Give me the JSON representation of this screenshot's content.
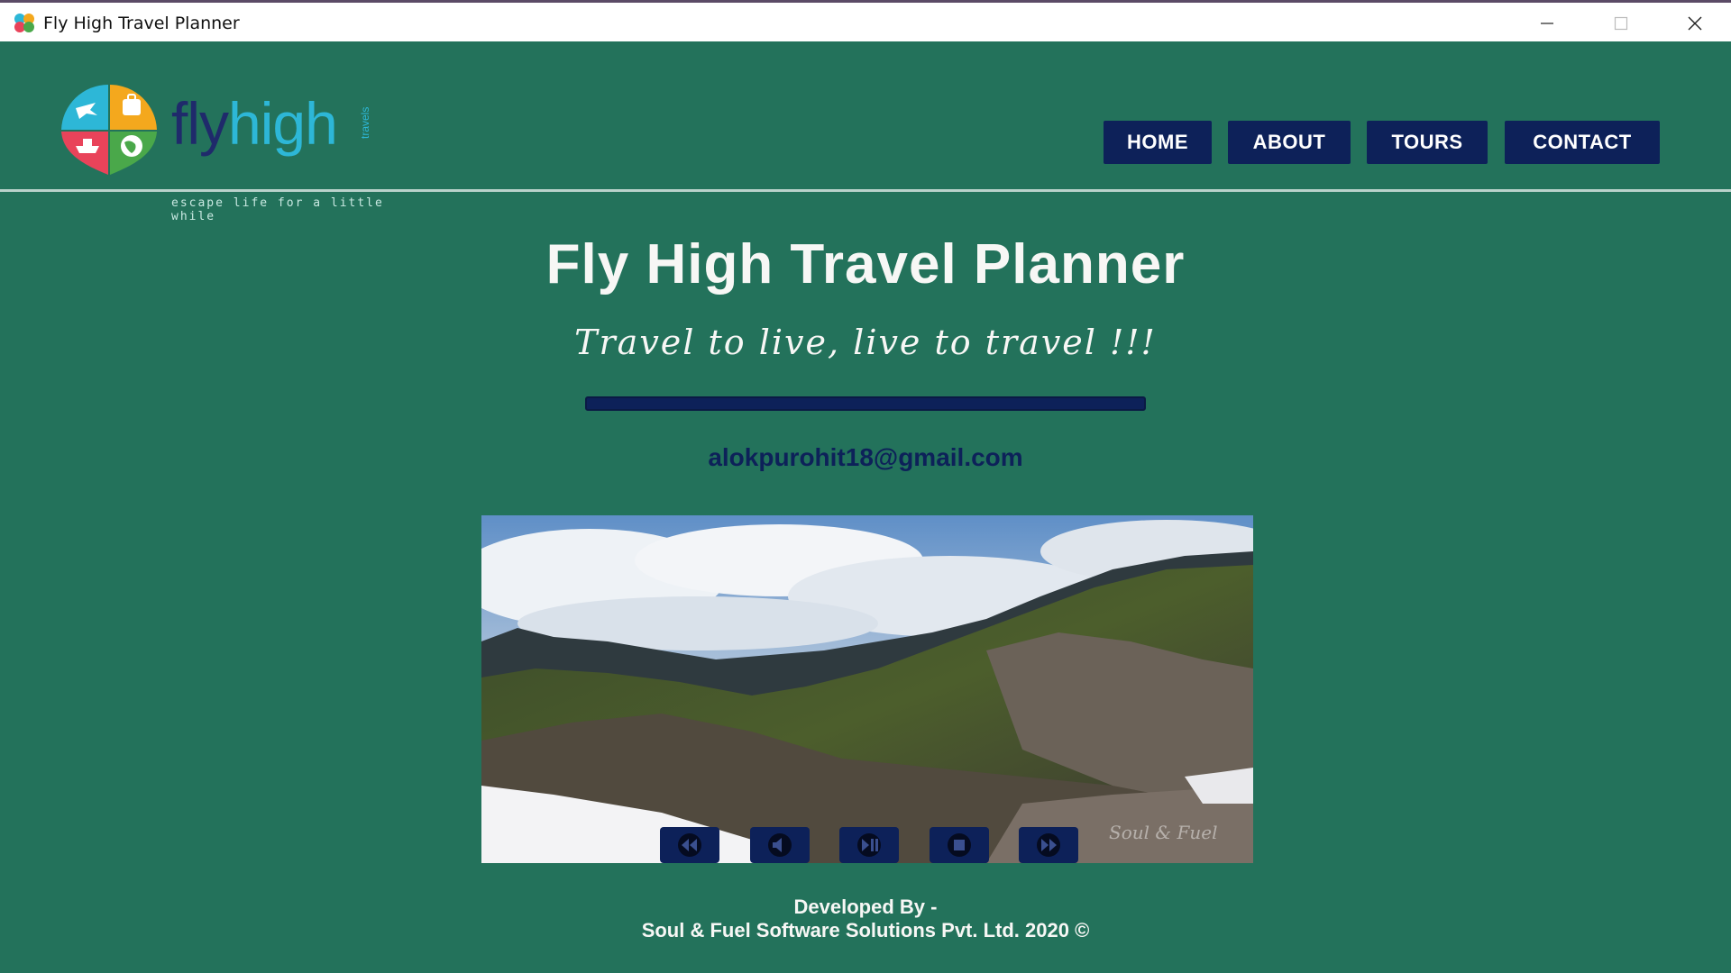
{
  "window": {
    "title": "Fly High Travel Planner",
    "app_icon": "flyhigh-logo-icon",
    "controls": [
      "minimize-icon",
      "maximize-icon",
      "close-icon"
    ]
  },
  "header": {
    "logo": {
      "word_fly": "fly",
      "word_high": "high",
      "vertical": "travels",
      "tagline": "escape life for a little while",
      "colors": {
        "fly": "#1f2a6b",
        "high": "#2db7d7"
      }
    },
    "nav": [
      {
        "label": "HOME"
      },
      {
        "label": "ABOUT"
      },
      {
        "label": "TOURS"
      },
      {
        "label": "CONTACT"
      }
    ]
  },
  "hero": {
    "title": "Fly High Travel Planner",
    "tagline": "Travel to live, live to travel !!!",
    "email": "alokpurohit18@gmail.com"
  },
  "video": {
    "watermark": "Soul & Fuel",
    "controls": [
      {
        "icon": "rewind-icon"
      },
      {
        "icon": "mute-icon"
      },
      {
        "icon": "play-pause-icon"
      },
      {
        "icon": "stop-icon"
      },
      {
        "icon": "fast-forward-icon"
      }
    ]
  },
  "footer": {
    "line1": "Developed By -",
    "line2": "Soul & Fuel Software Solutions Pvt. Ltd. 2020 ©"
  },
  "colors": {
    "background": "#23725b",
    "nav_button": "#0d2159",
    "text_light": "#f7f7f5",
    "email": "#0d2159"
  }
}
